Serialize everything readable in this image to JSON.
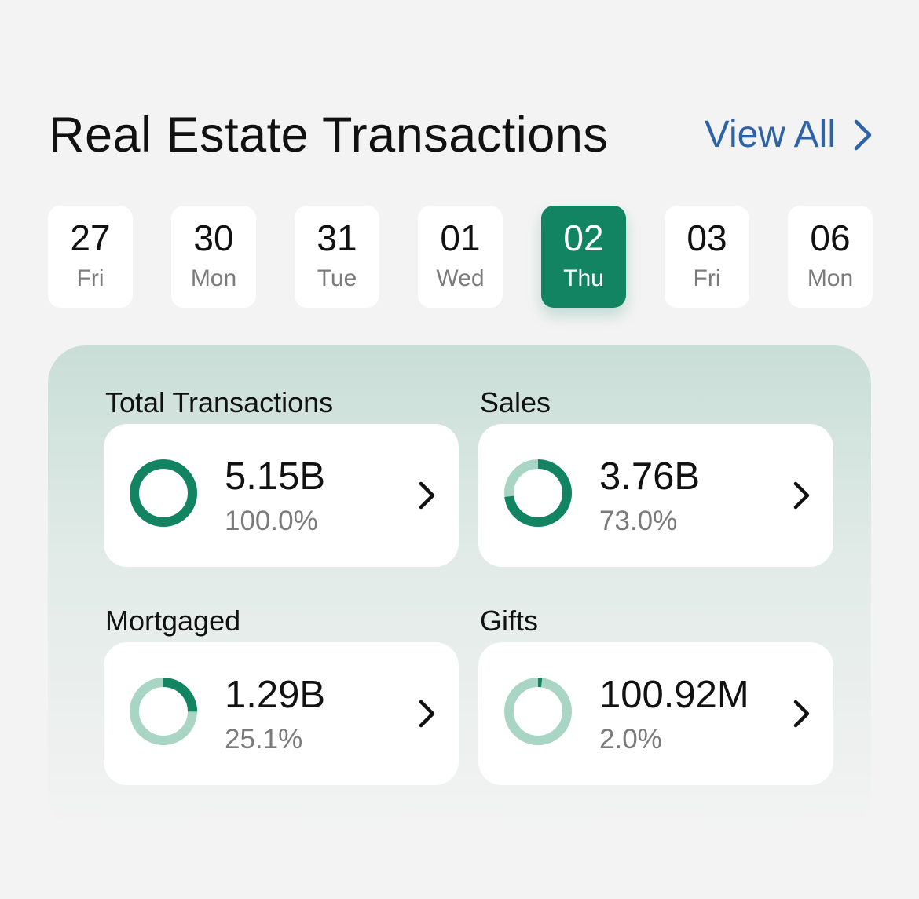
{
  "header": {
    "title": "Real Estate Transactions",
    "view_all_label": "View All"
  },
  "dates": [
    {
      "day": "27",
      "weekday": "Fri",
      "selected": false
    },
    {
      "day": "30",
      "weekday": "Mon",
      "selected": false
    },
    {
      "day": "31",
      "weekday": "Tue",
      "selected": false
    },
    {
      "day": "01",
      "weekday": "Wed",
      "selected": false
    },
    {
      "day": "02",
      "weekday": "Thu",
      "selected": true
    },
    {
      "day": "03",
      "weekday": "Fri",
      "selected": false
    },
    {
      "day": "06",
      "weekday": "Mon",
      "selected": false
    }
  ],
  "stats": [
    {
      "label": "Total Transactions",
      "value": "5.15B",
      "percent_text": "100.0%",
      "fraction": 1.0
    },
    {
      "label": "Sales",
      "value": "3.76B",
      "percent_text": "73.0%",
      "fraction": 0.73
    },
    {
      "label": "Mortgaged",
      "value": "1.29B",
      "percent_text": "25.1%",
      "fraction": 0.251
    },
    {
      "label": "Gifts",
      "value": "100.92M",
      "percent_text": "2.0%",
      "fraction": 0.02
    }
  ],
  "colors": {
    "accent": "#138462",
    "ring_track": "#a8d5c4",
    "link": "#2f63a8",
    "background": "#f3f3f3"
  }
}
